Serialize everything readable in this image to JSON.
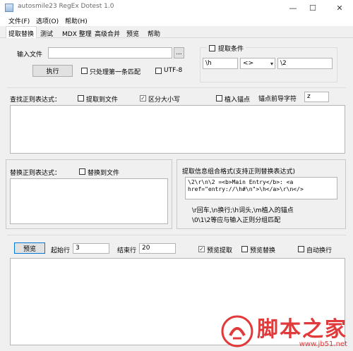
{
  "window": {
    "title": "autosmile23 RegEx Dotest 1.0",
    "minimize_glyph": "—",
    "maximize_glyph": "☐",
    "close_glyph": "✕"
  },
  "menu": [
    "文件(F)",
    "选项(O)",
    "帮助(H)"
  ],
  "tabs": [
    "提取替换",
    "测试",
    "MDX 整理",
    "高级合并",
    "预览",
    "帮助"
  ],
  "input_file": {
    "label": "输入文件",
    "value": "",
    "browse_label": "...",
    "execute_label": "执行",
    "first_match_only": {
      "label": "只处理第一条匹配",
      "checked": false
    },
    "utf8": {
      "label": "UTF-8",
      "checked": false
    }
  },
  "extract_condition": {
    "label": "提取条件",
    "checked": false,
    "left_value": "\\h",
    "operator_value": "<>",
    "right_value": "\\2"
  },
  "search_regex": {
    "label": "查找正则表达式：",
    "extract_to_file": {
      "label": "提取到文件",
      "checked": false
    },
    "case_sensitive": {
      "label": "区分大小写",
      "checked": true
    },
    "embed_anchor": {
      "label": "植入锚点",
      "checked": false
    },
    "anchor_prefix_label": "锚点前导字符",
    "anchor_prefix_value": "z",
    "value": ""
  },
  "replace_regex": {
    "label": "替换正则表达式：",
    "replace_to_file": {
      "label": "替换到文件",
      "checked": false
    },
    "value": ""
  },
  "extract_format": {
    "label": "提取信息组合格式(支持正则替换表达式)",
    "value_line1": "\\2\\r\\n\\2 =<b>Main Entry</b>: <a",
    "value_line2": "href=\"entry://\\h#\\n\">\\h</a>\\r\\n</>",
    "note1": "\\r回车,\\n换行;\\h词头,\\m植入的锚点",
    "note2": "\\0\\1\\2等应与输入正则分组匹配"
  },
  "preview": {
    "button_label": "预览",
    "start_line_label": "起始行",
    "start_line_value": "3",
    "end_line_label": "结束行",
    "end_line_value": "20",
    "preview_extract": {
      "label": "预览提取",
      "checked": true
    },
    "preview_replace": {
      "label": "预览替换",
      "checked": false
    },
    "auto_wrap": {
      "label": "自动换行",
      "checked": false
    },
    "output": ""
  },
  "watermark": {
    "main": "脚本之家",
    "sub": "www.jb51.net"
  }
}
